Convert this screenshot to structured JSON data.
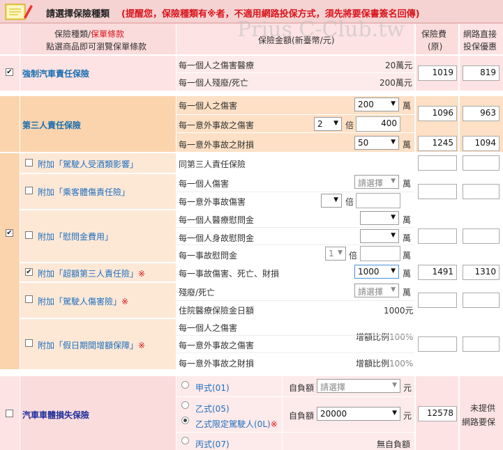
{
  "header": {
    "title": "請選擇保險種類",
    "notice": "(提醒您，保險種類有※者，不適用網路投保方式，須先將要保書簽名回傳)",
    "watermark": "Prius C-Club.tw"
  },
  "columns": {
    "type_line1": "保險種類/",
    "type_line1_red": "保單條款",
    "type_line2": "點選商品即可瀏覽保單條款",
    "amount": "保險金額(新臺幣/元)",
    "premium_line1": "保險費",
    "premium_line2": "(原)",
    "net_line1": "網路直接",
    "net_line2": "投保優惠"
  },
  "compulsory": {
    "name": "強制汽車責任保險",
    "checked": "✔",
    "item1": "每一個人之傷害醫療",
    "value1": "20萬元",
    "item2": "每一個人殘廢/死亡",
    "value2": "200萬元",
    "premium": "1019",
    "net": "819"
  },
  "third_party": {
    "checked": "✔",
    "name": "第三人責任保險",
    "item1": "每一個人之傷害",
    "sel1": "200",
    "unit_wan": "萬",
    "item2": "每一意外事故之傷害",
    "sel2": "2",
    "bei": "倍",
    "input2": "400",
    "item3": "每一意外事故之財損",
    "sel3": "50",
    "premium1": "1096",
    "net1": "963",
    "premium3": "1245",
    "net3": "1094"
  },
  "addon_drunk": {
    "name": "附加「駕駛人受酒類影響」",
    "desc": "同第三人責任保險"
  },
  "addon_passenger": {
    "name": "附加「乘客體傷責任險」",
    "item1": "每一個人傷害",
    "sel1": "請選擇",
    "item2": "每一意外事故傷害",
    "sel2": ""
  },
  "addon_consolation": {
    "name": "附加「慰問金費用」",
    "item1": "每一個人醫療慰問金",
    "item2": "每一個人身故慰問金",
    "item3": "每一事故慰問金",
    "sel3": "1"
  },
  "addon_excess": {
    "checked": "✔",
    "name": "附加「超額第三人責任險」",
    "mark": "※",
    "item1": "每一事故傷害、死亡、財損",
    "sel1": "1000",
    "premium": "1491",
    "net": "1310"
  },
  "addon_driver": {
    "name": "附加「駕駛人傷害險」",
    "mark": "※",
    "item1": "殘廢/死亡",
    "sel1": "請選擇",
    "item2": "住院醫療保險金日額",
    "value2": "1000元"
  },
  "addon_holiday": {
    "name": "附加「假日期間增額保障」",
    "mark": "※",
    "item1": "每一個人之傷害",
    "item2": "每一意外事故之傷害",
    "item3": "每一意外事故之財損",
    "ratio_label": "增額比例",
    "ratio": "100%"
  },
  "vehicle": {
    "name": "汽車車體損失保險",
    "opt1": "甲式(01)",
    "opt2": "乙式(05)",
    "opt3": "乙式限定駕駛人(0L)",
    "opt3_mark": "※",
    "opt4": "丙式(07)",
    "deductible": "自負額",
    "sel1": "請選擇",
    "sel2": "20000",
    "unit_yuan": "元",
    "no_deduct": "無自負額",
    "premium": "12578",
    "net_line1": "未提供",
    "net_line2": "網路要保"
  },
  "colors": {
    "pink": "#fde3e3",
    "orange": "#fde0c5",
    "red": "#d9141b",
    "link": "#1a6fb0",
    "navy": "#1f2e9c"
  }
}
